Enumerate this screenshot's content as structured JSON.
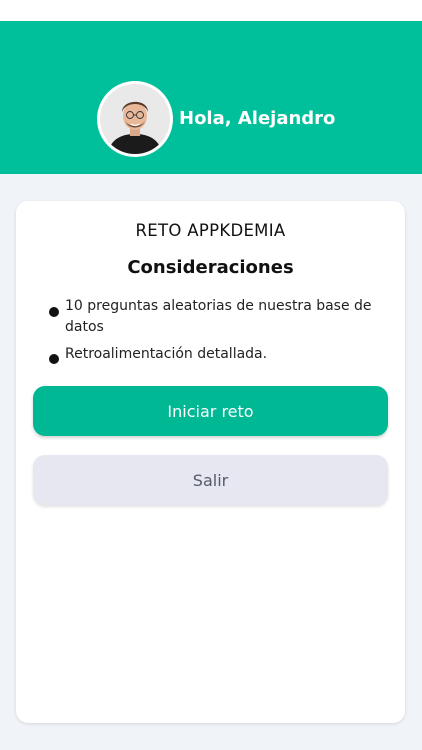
{
  "header": {
    "greeting": "Hola, Alejandro",
    "background_color": "#00c09b",
    "avatar_icon": "user-avatar-photo"
  },
  "card": {
    "title": "RETO APPKDEMIA",
    "subtitle": "Consideraciones",
    "bullets": [
      "10 preguntas aleatorias de nuestra base de datos",
      "Retroalimentación detallada."
    ],
    "primary_button": "Iniciar reto",
    "secondary_button": "Salir"
  },
  "colors": {
    "accent": "#00b894",
    "secondary_button_bg": "#e6e7f0",
    "page_bg": "#f0f3f8"
  }
}
